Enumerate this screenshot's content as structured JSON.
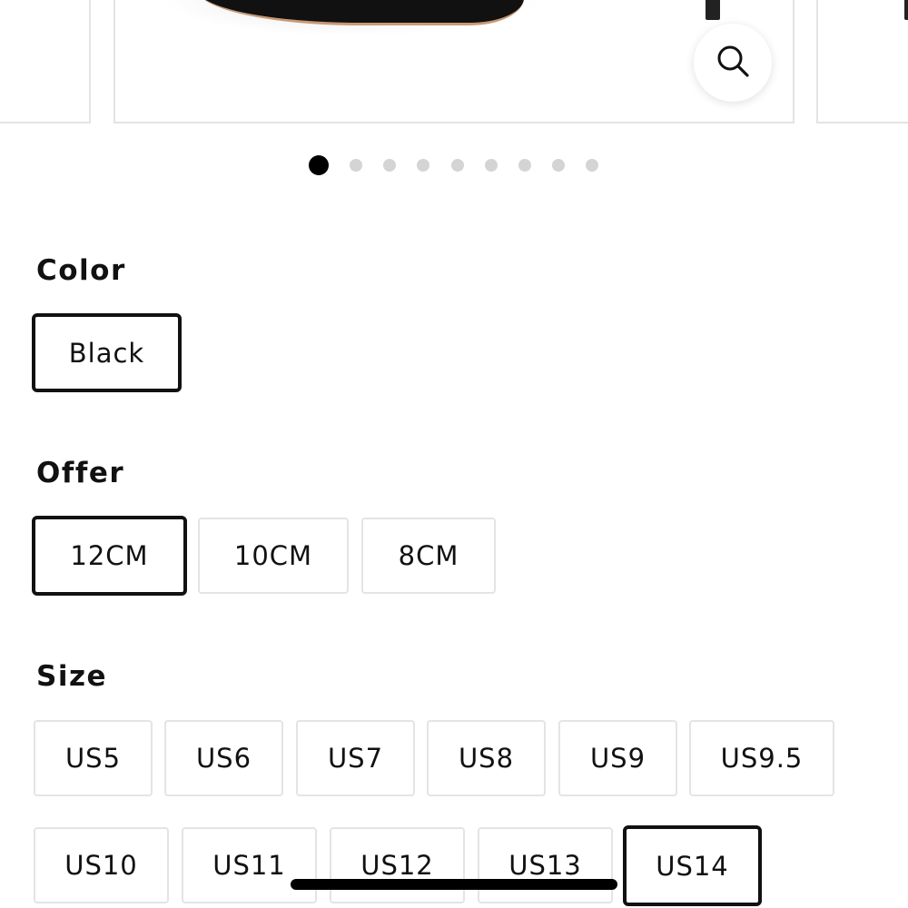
{
  "gallery": {
    "zoom_icon": "search-icon",
    "dot_count": 9,
    "active_dot": 0
  },
  "color": {
    "label": "Color",
    "options": [
      "Black"
    ],
    "selected": "Black"
  },
  "offer": {
    "label": "Offer",
    "options": [
      "12CM",
      "10CM",
      "8CM"
    ],
    "selected": "12CM"
  },
  "size": {
    "label": "Size",
    "options": [
      "US5",
      "US6",
      "US7",
      "US8",
      "US9",
      "US9.5",
      "US10",
      "US11",
      "US12",
      "US13",
      "US14"
    ],
    "selected": "US14"
  },
  "colors": {
    "accent": "#111111",
    "border": "#e4e4e4",
    "dot_inactive": "#d4d4d4"
  }
}
